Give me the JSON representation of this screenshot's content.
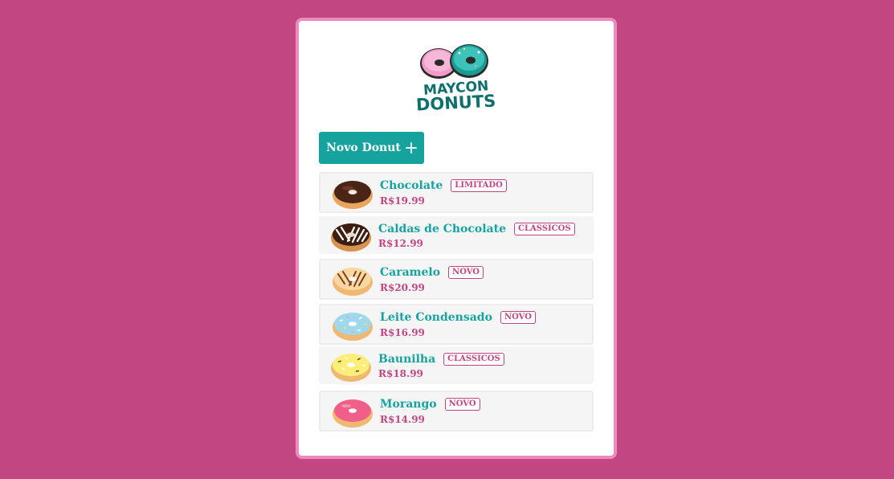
{
  "brand": {
    "logo_line1": "MAYCON",
    "logo_line2": "DONUTS",
    "colors": {
      "pink": "#c14681",
      "teal": "#16a39e",
      "light_pink": "#ec8cbd"
    }
  },
  "toolbar": {
    "new_donut_label": "Novo Donut",
    "new_donut_icon": "plus-icon"
  },
  "donuts": [
    {
      "name": "Chocolate",
      "badge": "LIMITADO",
      "price": "R$19.99",
      "style": "chocolate-icing"
    },
    {
      "name": "Caldas de Chocolate",
      "badge": "CLASSICOS",
      "price": "R$12.99",
      "style": "chocolate-drizzle"
    },
    {
      "name": "Caramelo",
      "badge": "NOVO",
      "price": "R$20.99",
      "style": "caramel-drizzle"
    },
    {
      "name": "Leite Condensado",
      "badge": "NOVO",
      "price": "R$16.99",
      "style": "blue-sprinkles"
    },
    {
      "name": "Baunilha",
      "badge": "CLASSICOS",
      "price": "R$18.99",
      "style": "yellow-sprinkles"
    },
    {
      "name": "Morango",
      "badge": "NOVO",
      "price": "R$14.99",
      "style": "strawberry"
    }
  ]
}
